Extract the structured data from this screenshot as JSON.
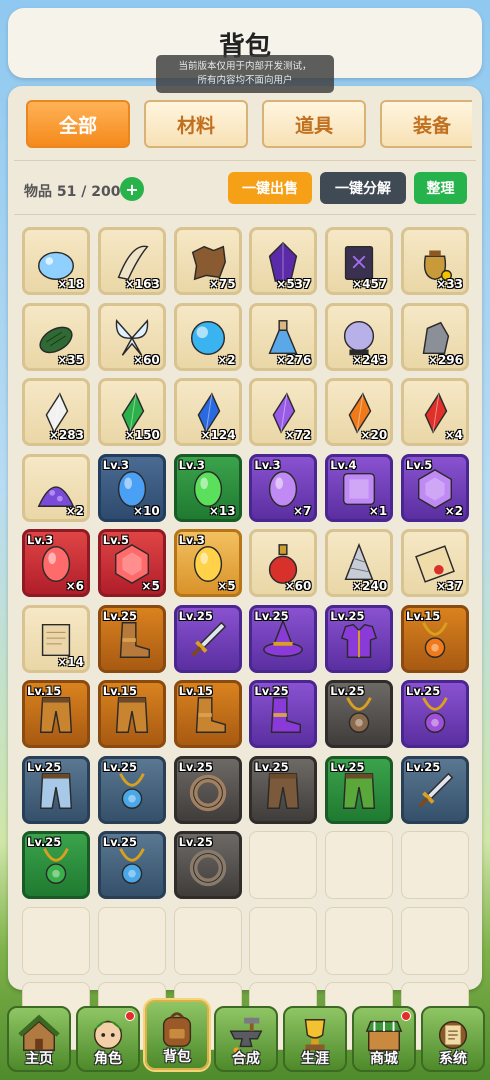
{
  "header": {
    "title": "背包"
  },
  "notice": {
    "line1": "当前版本仅用于内部开发测试，",
    "line2": "所有内容均不面向用户"
  },
  "tabs": [
    {
      "label": "全部",
      "active": true
    },
    {
      "label": "材料",
      "active": false
    },
    {
      "label": "道具",
      "active": false
    },
    {
      "label": "装备",
      "active": false
    }
  ],
  "inventory": {
    "count_label": "物品 51 / 200",
    "expand_label": "+",
    "sell_label": "一键出售",
    "dismantle_label": "一键分解",
    "sort_label": "整理",
    "items": [
      {
        "icon": "slime-gel-icon",
        "qty": "×18",
        "q": "plain",
        "shape": "blob",
        "c": "#8fd0ff"
      },
      {
        "icon": "fang-icon",
        "qty": "×163",
        "q": "plain",
        "shape": "fang",
        "c": "#efe3c8"
      },
      {
        "icon": "leather-hide-icon",
        "qty": "×75",
        "q": "plain",
        "shape": "hide",
        "c": "#8a5a30"
      },
      {
        "icon": "dark-crystal-icon",
        "qty": "×537",
        "q": "plain",
        "shape": "crystal",
        "c": "#5a2aa8"
      },
      {
        "icon": "dark-tome-icon",
        "qty": "×457",
        "q": "plain",
        "shape": "book",
        "c": "#3a3050"
      },
      {
        "icon": "gold-pouch-icon",
        "qty": "×33",
        "q": "plain",
        "shape": "bag",
        "c": "#c99a3a"
      },
      {
        "icon": "green-cocoon-icon",
        "qty": "×35",
        "q": "plain",
        "shape": "cocoon",
        "c": "#2f6a35"
      },
      {
        "icon": "fairy-wings-icon",
        "qty": "×60",
        "q": "plain",
        "shape": "wings",
        "c": "#dff1ff"
      },
      {
        "icon": "water-orb-icon",
        "qty": "×2",
        "q": "plain",
        "shape": "orb",
        "c": "#3ab4f0"
      },
      {
        "icon": "potion-flask-icon",
        "qty": "×276",
        "q": "plain",
        "shape": "flask",
        "c": "#5aa8e8"
      },
      {
        "icon": "crystal-ball-icon",
        "qty": "×243",
        "q": "plain",
        "shape": "ball",
        "c": "#b8b0e8"
      },
      {
        "icon": "iron-ore-icon",
        "qty": "×296",
        "q": "plain",
        "shape": "rock",
        "c": "#8a8f98"
      },
      {
        "icon": "white-shard-icon",
        "qty": "×283",
        "q": "plain",
        "shape": "shard",
        "c": "#f2f2f2"
      },
      {
        "icon": "green-shard-icon",
        "qty": "×150",
        "q": "plain",
        "shape": "shard",
        "c": "#2cb04a"
      },
      {
        "icon": "blue-shard-icon",
        "qty": "×124",
        "q": "plain",
        "shape": "shard",
        "c": "#2a6ae0"
      },
      {
        "icon": "purple-shard-icon",
        "qty": "×72",
        "q": "plain",
        "shape": "shard",
        "c": "#9a5ae8"
      },
      {
        "icon": "orange-shard-icon",
        "qty": "×20",
        "q": "plain",
        "shape": "shard",
        "c": "#f07a1a"
      },
      {
        "icon": "red-shard-icon",
        "qty": "×4",
        "q": "plain",
        "shape": "shard",
        "c": "#e0302a"
      },
      {
        "icon": "crystal-dust-icon",
        "qty": "×2",
        "q": "plain",
        "shape": "pile",
        "c": "#7a4ad8"
      },
      {
        "icon": "blue-gem-icon",
        "qty": "×10",
        "lv": "Lv.3",
        "q": "blue",
        "shape": "oval",
        "c": "#4aa0f5"
      },
      {
        "icon": "green-gem-icon",
        "qty": "×13",
        "lv": "Lv.3",
        "q": "green",
        "shape": "oval",
        "c": "#5ae05a"
      },
      {
        "icon": "purple-gem-icon",
        "qty": "×7",
        "lv": "Lv.3",
        "q": "purple",
        "shape": "oval",
        "c": "#c08af5"
      },
      {
        "icon": "purple-gem-icon",
        "qty": "×1",
        "lv": "Lv.4",
        "q": "purple",
        "shape": "square",
        "c": "#c08af5"
      },
      {
        "icon": "purple-gem-icon",
        "qty": "×2",
        "lv": "Lv.5",
        "q": "purple",
        "shape": "hex",
        "c": "#c08af5"
      },
      {
        "icon": "red-gem-icon",
        "qty": "×6",
        "lv": "Lv.3",
        "q": "red",
        "shape": "oval",
        "c": "#ff6a6a"
      },
      {
        "icon": "red-gem-icon",
        "qty": "×5",
        "lv": "Lv.5",
        "q": "red",
        "shape": "hex",
        "c": "#ff6a6a"
      },
      {
        "icon": "gold-gem-icon",
        "qty": "×5",
        "lv": "Lv.3",
        "q": "gold",
        "shape": "oval",
        "c": "#ffd24a"
      },
      {
        "icon": "red-potion-icon",
        "qty": "×60",
        "q": "plain",
        "shape": "potion",
        "c": "#d8302a"
      },
      {
        "icon": "drill-shell-icon",
        "qty": "×240",
        "q": "plain",
        "shape": "drill",
        "c": "#c8cdd5"
      },
      {
        "icon": "scroll-icon",
        "qty": "×37",
        "q": "plain",
        "shape": "scroll",
        "c": "#f0dca8"
      },
      {
        "icon": "parchment-icon",
        "qty": "×14",
        "q": "plain",
        "shape": "paper",
        "c": "#ead6a8"
      },
      {
        "icon": "boots-icon",
        "lv": "Lv.25",
        "q": "orange",
        "shape": "boots",
        "c": "#b87a3a"
      },
      {
        "icon": "sword-icon",
        "lv": "Lv.25",
        "q": "purple",
        "shape": "sword",
        "c": "#dfe4ee"
      },
      {
        "icon": "wizard-hat-icon",
        "lv": "Lv.25",
        "q": "purple",
        "shape": "hat",
        "c": "#8a3ad8"
      },
      {
        "icon": "armor-icon",
        "lv": "Lv.25",
        "q": "purple",
        "shape": "armor",
        "c": "#8a3ad8"
      },
      {
        "icon": "amulet-icon",
        "lv": "Lv.15",
        "q": "orange",
        "shape": "amulet",
        "c": "#f07a1a"
      },
      {
        "icon": "leather-pants-icon",
        "lv": "Lv.15",
        "q": "orange",
        "shape": "pants",
        "c": "#c9842f"
      },
      {
        "icon": "leather-pants-icon",
        "lv": "Lv.15",
        "q": "orange",
        "shape": "pants",
        "c": "#c9842f"
      },
      {
        "icon": "boots-icon",
        "lv": "Lv.15",
        "q": "orange",
        "shape": "boots",
        "c": "#c9842f"
      },
      {
        "icon": "boots-icon",
        "lv": "Lv.25",
        "q": "purple",
        "shape": "boots",
        "c": "#8a3ad8"
      },
      {
        "icon": "amulet-icon",
        "lv": "Lv.25",
        "q": "gray",
        "shape": "amulet",
        "c": "#8a6a4a"
      },
      {
        "icon": "amulet-icon",
        "lv": "Lv.25",
        "q": "purple",
        "shape": "amulet",
        "c": "#a050d8"
      },
      {
        "icon": "cloth-pants-icon",
        "lv": "Lv.25",
        "q": "steel",
        "shape": "pants",
        "c": "#a8c8e8"
      },
      {
        "icon": "amulet-icon",
        "lv": "Lv.25",
        "q": "steel",
        "shape": "amulet",
        "c": "#4aa8e8"
      },
      {
        "icon": "ring-icon",
        "lv": "Lv.25",
        "q": "gray",
        "shape": "ring",
        "c": "#a08060"
      },
      {
        "icon": "leather-pants-icon",
        "lv": "Lv.25",
        "q": "gray",
        "shape": "pants",
        "c": "#7a5a3a"
      },
      {
        "icon": "leaf-pants-icon",
        "lv": "Lv.25",
        "q": "green",
        "shape": "pants",
        "c": "#5aa83a"
      },
      {
        "icon": "sword-icon",
        "lv": "Lv.25",
        "q": "steel",
        "shape": "sword",
        "c": "#dfe4ee"
      },
      {
        "icon": "amulet-icon",
        "lv": "Lv.25",
        "q": "green",
        "shape": "amulet",
        "c": "#3ab04a"
      },
      {
        "icon": "amulet-icon",
        "lv": "Lv.25",
        "q": "steel",
        "shape": "amulet",
        "c": "#4aa8e8"
      },
      {
        "icon": "ring-icon",
        "lv": "Lv.25",
        "q": "gray",
        "shape": "ring",
        "c": "#8a7a6a"
      }
    ]
  },
  "nav": [
    {
      "label": "主页",
      "icon": "home-icon",
      "active": false,
      "dot": false
    },
    {
      "label": "角色",
      "icon": "character-icon",
      "active": false,
      "dot": true
    },
    {
      "label": "背包",
      "icon": "backpack-icon",
      "active": true,
      "dot": false
    },
    {
      "label": "合成",
      "icon": "anvil-icon",
      "active": false,
      "dot": false
    },
    {
      "label": "生涯",
      "icon": "trophy-icon",
      "active": false,
      "dot": false
    },
    {
      "label": "商城",
      "icon": "shop-icon",
      "active": false,
      "dot": true
    },
    {
      "label": "系统",
      "icon": "settings-icon",
      "active": false,
      "dot": false
    }
  ]
}
